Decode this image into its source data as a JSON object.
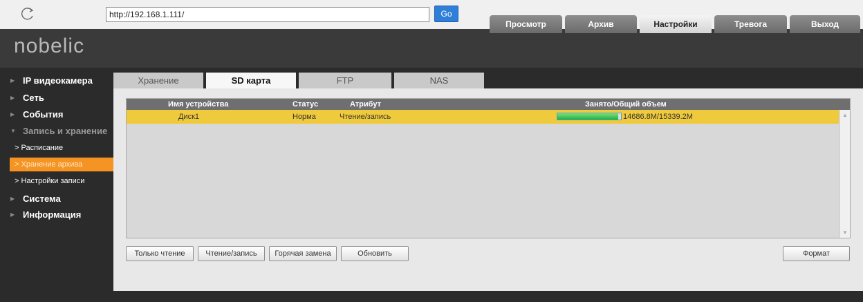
{
  "browser": {
    "url": "http://192.168.1.111/",
    "go_label": "Go"
  },
  "header": {
    "logo": "nobelic",
    "nav": [
      {
        "label": "Просмотр",
        "active": false
      },
      {
        "label": "Архив",
        "active": false
      },
      {
        "label": "Настройки",
        "active": true
      },
      {
        "label": "Тревога",
        "active": false
      },
      {
        "label": "Выход",
        "active": false
      }
    ]
  },
  "sidebar": {
    "items": [
      {
        "label": "IP видеокамера"
      },
      {
        "label": "Сеть"
      },
      {
        "label": "События"
      },
      {
        "label": "Запись и хранение",
        "expanded": true
      }
    ],
    "sub_items": [
      {
        "label": "Расписание"
      },
      {
        "label": "Хранение архива",
        "active": true
      },
      {
        "label": "Настройки записи"
      }
    ],
    "items_after": [
      {
        "label": "Система"
      },
      {
        "label": "Информация"
      }
    ]
  },
  "tabs": [
    {
      "label": "Хранение",
      "active": false
    },
    {
      "label": "SD карта",
      "active": true
    },
    {
      "label": "FTP",
      "active": false
    },
    {
      "label": "NAS",
      "active": false
    }
  ],
  "table": {
    "columns": [
      "Имя устройства",
      "Статус",
      "Атрибут",
      "Занято/Общий объем"
    ],
    "rows": [
      {
        "device": "Диск1",
        "status": "Норма",
        "attribute": "Чтение/запись",
        "usage": "14686.8M/15339.2M",
        "used_fraction": 0.957
      }
    ]
  },
  "buttons": {
    "read_only": "Только чтение",
    "read_write": "Чтение/запись",
    "hot_swap": "Горячая замена",
    "refresh": "Обновить",
    "format": "Формат"
  },
  "colors": {
    "accent": "#f59422",
    "selected_row": "#efca3c",
    "go_button": "#2f7fd8"
  }
}
